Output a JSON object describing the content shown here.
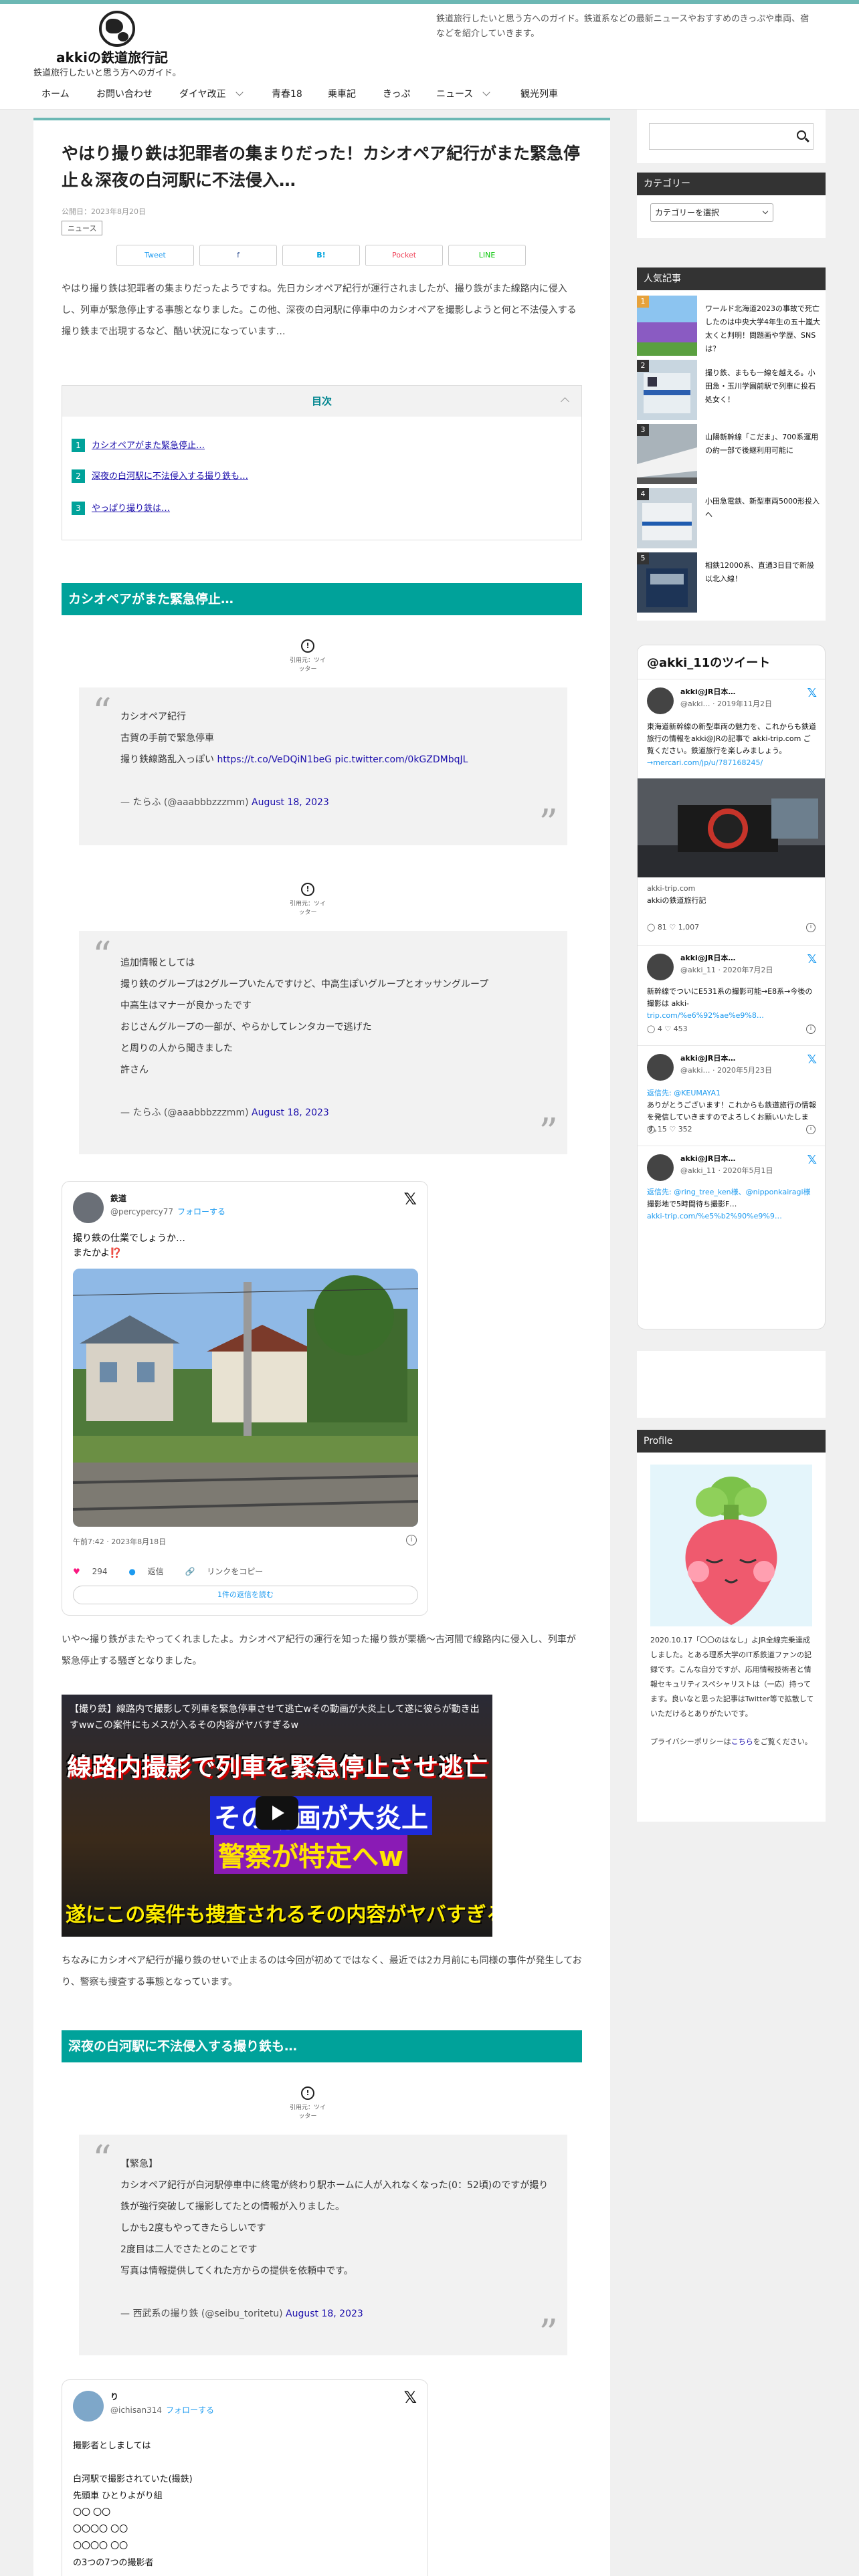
{
  "header": {
    "site_title": "akkiの鉄道旅行記",
    "site_subtitle": "鉄道旅行したいと思う方へのガイド。",
    "description": "鉄道旅行したいと思う方へのガイド。鉄道系などの最新ニュースやおすすめのきっぷや車両、宿などを紹介していきます。"
  },
  "nav": [
    {
      "label": "ホーム"
    },
    {
      "label": "お問い合わせ"
    },
    {
      "label": "ダイヤ改正"
    },
    {
      "label": "青春18"
    },
    {
      "label": "乗車記"
    },
    {
      "label": "きっぷ"
    },
    {
      "label": "ニュース"
    },
    {
      "label": "観光列車"
    }
  ],
  "post": {
    "title": "やはり撮り鉄は犯罪者の集まりだった！カシオペア紀行がまた緊急停止＆深夜の白河駅に不法侵入…",
    "date": "公開日：2023年8月20日",
    "category": "ニュース",
    "share": [
      "Tweet",
      "",
      "B!",
      "Pocket",
      "LINE"
    ],
    "intro": "やはり撮り鉄は犯罪者の集まりだったようですね。先日カシオペア紀行が運行されましたが、撮り鉄がまた線路内に侵入し、列車が緊急停止する事態となりました。この他、深夜の白河駅に停車中のカシオペアを撮影しようと何と不法侵入する撮り鉄まで出現するなど、酷い状況になっています…"
  },
  "toc": {
    "title": "目次",
    "items": [
      {
        "num": "1",
        "label": "カシオペアがまた緊急停止…"
      },
      {
        "num": "2",
        "label": "深夜の白河駅に不法侵入する撮り鉄も…"
      },
      {
        "num": "3",
        "label": "やっぱり撮り鉄は…"
      }
    ]
  },
  "sections": {
    "s1": "カシオペアがまた緊急停止…",
    "s2": "深夜の白河駅に不法侵入する撮り鉄も…"
  },
  "source_note": "引用元：ツイッター",
  "quote1": {
    "lines": [
      "カシオペア紀行",
      "古賀の手前で緊急停車",
      "撮り鉄線路乱入っぽい"
    ],
    "link1": "https://t.co/VeDQiN1beG",
    "link2": "pic.twitter.com/0kGZDMbqJL",
    "source": "— たらふ (@aaabbbzzzmm)",
    "date": "August 18, 2023"
  },
  "quote2": {
    "lines": [
      "追加情報としては",
      "撮り鉄のグループは2グループいたんですけど、中高生ぽいグループとオッサングループ",
      "中高生はマナーが良かったです",
      "おじさんグループの一部が、やらかしてレンタカーで逃げた",
      "と周りの人から聞きました",
      "許さん"
    ],
    "source": "— たらふ (@aaabbbzzzmm)",
    "date": "August 18, 2023"
  },
  "tweet1": {
    "name": "鉄道",
    "handle": "@percypercy77",
    "follow": "フォローする",
    "text1": "撮り鉄の仕業でしょうか…",
    "text2": "またかよ⁉️",
    "meta": "午前7:42 · 2023年8月18日",
    "likes": "294",
    "reply": "返信",
    "copy": "リンクをコピー",
    "more": "1件の返信を読む"
  },
  "para1": "いや〜撮り鉄がまたやってくれましたよ。カシオペア紀行の運行を知った撮り鉄が栗橋〜古河間で線路内に侵入し、列車が緊急停止する騒ぎとなりました。",
  "video": {
    "caption": "【撮り鉄】線路内で撮影して列車を緊急停車させて逃亡wその動画が大炎上して遂に彼らが動き出すwwこの案件にもメスが入るその内容がヤバすぎるw",
    "big1": "線路内撮影で列車を緊急停止させ逃亡",
    "big2": "その動画が大炎上",
    "big3": "警察が特定へw",
    "big4": "遂にこの案件も捜査されるその内容がヤバすぎるw"
  },
  "para2": "ちなみにカシオペア紀行が撮り鉄のせいで止まるのは今回が初めてではなく、最近では2カ月前にも同様の事件が発生しており、警察も捜査する事態となっています。",
  "quote3": {
    "lines": [
      "【緊急】",
      "カシオペア紀行が白河駅停車中に終電が終わり駅ホームに人が入れなくなった(0：52頃)のですが撮り鉄が強行突破して撮影してたとの情報が入りました。",
      "しかも2度もやってきたらしいです",
      "2度目は二人でさたとのことです",
      "写真は情報提供してくれた方からの提供を依頼中です。"
    ],
    "source": "— 西武系の撮り鉄 (@seibu_toritetu)",
    "date": "August 18, 2023"
  },
  "tweet2": {
    "name": "り",
    "handle": "@ichisan314",
    "follow": "フォローする",
    "lines": [
      "撮影者としましては",
      "",
      "白河駅で撮影されていた(撮鉄)",
      "先頭車 ひとりよがり組",
      "〇〇 〇〇",
      "〇〇〇〇 〇〇",
      "〇〇〇〇 〇〇",
      "の3つの7つの撮影者"
    ]
  },
  "sidebar": {
    "search_placeholder": "",
    "category_title": "カテゴリー",
    "category_select": "カテゴリーを選択",
    "popular_title": "人気記事",
    "popular": [
      {
        "rank": "1",
        "text": "ワールド北海道2023の事故で死亡したのは中央大学4年生の五十嵐大太くと判明！問題画や学歴、SNSは？"
      },
      {
        "rank": "2",
        "text": "撮り鉄、まもも一線を越える。小田急・玉川学園前駅で列車に投石処女く！"
      },
      {
        "rank": "3",
        "text": "山陽新幹線「こだま」、700系運用の約一部で後継利用可能に"
      },
      {
        "rank": "4",
        "text": "小田急電鉄、新型車両5000形投入へ"
      },
      {
        "rank": "5",
        "text": "相鉄12000系、直通3日目で新設以北入線！"
      }
    ],
    "timeline": {
      "title": "@akki_11のツイート",
      "items": [
        {
          "name": "akki@JR日本…",
          "handle": "@akki…",
          "date": "2019年11月2日",
          "body": "東海道新幹線の新型車両の魅力を、これからも鉄道旅行の情報をakki@JRの記事で akki-trip.com ご覧ください。鉄道旅行を楽しみましょう。",
          "link": "→mercari.com/jp/u/787168245/",
          "card_site": "akki-trip.com",
          "card_title": "akkiの鉄道旅行記",
          "likes": "81",
          "rts": "1,007"
        },
        {
          "name": "akki@JR日本…",
          "handle": "@akki_11",
          "date": "2020年7月2日",
          "body": "新幹線でついにE531系の撮影可能→E8系→今後の撮影は akki-",
          "link": "trip.com/%e6%92%ae%e9%8…",
          "likes": "4",
          "rts": "453"
        },
        {
          "name": "akki@JR日本…",
          "handle": "@akki…",
          "date": "2020年5月23日",
          "body": "返信先: @KEUMAYA1",
          "link": "",
          "body2": "ありがとうございます！これからも鉄道旅行の情報を発信していきますのでよろしくお願いいたします。",
          "likes": "15",
          "rts": "352"
        },
        {
          "name": "akki@JR日本…",
          "handle": "@akki_11",
          "date": "2020年5月1日",
          "body": "返信先: @ring_tree_ken様、@nipponkairagi様",
          "link": "akki-trip.com/%e5%b2%90%e9%9…",
          "body2": "撮影地で5時間待ち撮影F…",
          "likes": "",
          "rts": ""
        }
      ]
    },
    "profile_title": "Profile",
    "profile_text": "2020.10.17「〇〇のはなし」よJR全線完乗達成しました。とある理系大学のIT系鉄道ファンの記録です。こんな自分ですが、応用情報技術者と情報セキュリティスペシャリストは（一応）持ってます。良いなと思った記事はTwitter等で拡散していただけるとありがたいです。",
    "privacy_pre": "プライバシーポリシーは",
    "privacy_link": "こちら",
    "privacy_post": "をご覧ください。"
  }
}
